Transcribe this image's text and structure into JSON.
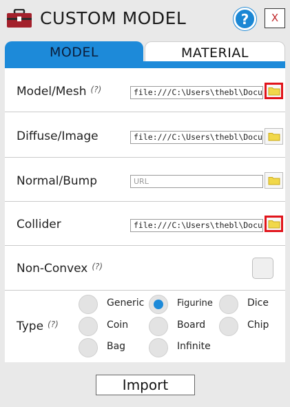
{
  "title": "CUSTOM MODEL",
  "header": {
    "help_label": "?",
    "close_label": "X",
    "app_icon": "toolbox-icon"
  },
  "tabs": [
    {
      "label": "MODEL",
      "active": true
    },
    {
      "label": "MATERIAL",
      "active": false
    }
  ],
  "fields": {
    "model_mesh": {
      "label": "Model/Mesh",
      "hint": "(?)",
      "value": "file:///C:\\Users\\thebl\\Docum",
      "highlighted": true
    },
    "diffuse_image": {
      "label": "Diffuse/Image",
      "value": "file:///C:\\Users\\thebl\\Docum",
      "highlighted": false
    },
    "normal_bump": {
      "label": "Normal/Bump",
      "value": "",
      "placeholder": "URL",
      "highlighted": false
    },
    "collider": {
      "label": "Collider",
      "value": "file:///C:\\Users\\thebl\\Docum",
      "highlighted": true
    }
  },
  "non_convex": {
    "label": "Non-Convex",
    "hint": "(?)",
    "checked": false
  },
  "type": {
    "label": "Type",
    "hint": "(?)",
    "options": [
      "Generic",
      "Figurine",
      "Dice",
      "Coin",
      "Board",
      "Chip",
      "Bag",
      "Infinite"
    ],
    "selected": "Figurine"
  },
  "import_label": "Import",
  "colors": {
    "accent": "#1d8ad9",
    "highlight": "#e1141b",
    "folder": "#f1d84a"
  }
}
